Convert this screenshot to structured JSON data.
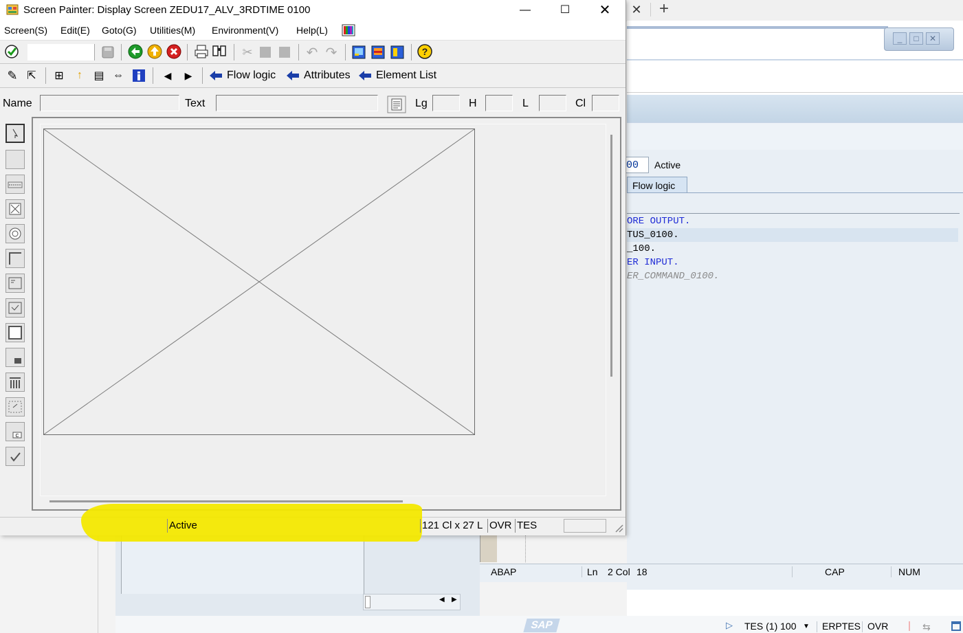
{
  "background_window": {
    "field_value": "00",
    "status": "Active",
    "tab": "Flow logic",
    "code_lines": [
      {
        "text": "ORE OUTPUT.",
        "color": "#1f2bd6"
      },
      {
        "text": "TUS_0100.",
        "color": "#000000"
      },
      {
        "text": "_100.",
        "color": "#000000"
      },
      {
        "text": "ER INPUT.",
        "color": "#1f2bd6"
      },
      {
        "text": "ER_COMMAND_0100.",
        "color": "#8a8a8a"
      }
    ],
    "editor_status": {
      "language": "ABAP",
      "ln_label": "Ln",
      "position": "2 Col",
      "col": "18",
      "cap": "CAP",
      "num": "NUM"
    },
    "footer": {
      "logo": "SAP",
      "system": "TES (1) 100",
      "server": "ERPTES",
      "mode": "OVR"
    }
  },
  "window": {
    "title": "Screen Painter:  Display Screen ZEDU17_ALV_3RDTIME 0100",
    "caption_buttons": [
      "minimize-icon",
      "maximize-icon",
      "close-icon"
    ]
  },
  "menu": [
    "Screen(S)",
    "Edit(E)",
    "Goto(G)",
    "Utilities(M)",
    "Environment(V)",
    "Help(L)"
  ],
  "toolbar2": {
    "flow_logic": "Flow logic",
    "attributes": "Attributes",
    "element_list": "Element List"
  },
  "fields": {
    "name_label": "Name",
    "name_value": "",
    "text_label": "Text",
    "text_value": "",
    "lg_label": "Lg",
    "lg_value": "",
    "h_label": "H",
    "h_value": "",
    "l_label": "L",
    "l_value": "",
    "cl_label": "Cl",
    "cl_value": ""
  },
  "status": {
    "message": "Active",
    "size": "121 Cl x 27 L",
    "mode": "OVR",
    "system": "TES"
  },
  "colors": {
    "highlight": "#f3e800",
    "keyword_blue": "#1f2bd6",
    "sap_panel": "#e9eff5"
  }
}
